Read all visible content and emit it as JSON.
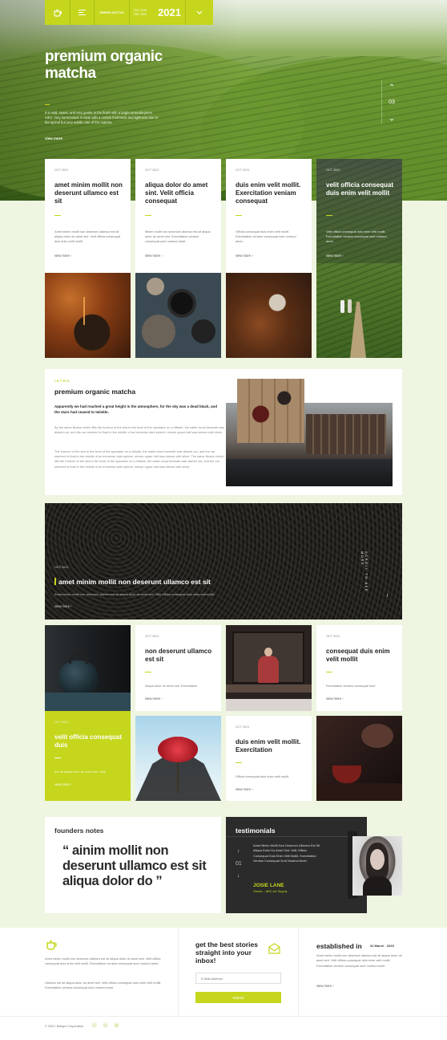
{
  "colors": {
    "accent": "#c5d61c",
    "dark": "#2b2b2b",
    "bg": "#eef5e1"
  },
  "header": {
    "logo_icon": "teapot-icon",
    "menu_icon": "menu-icon",
    "brand": "GREEN KATTLE",
    "date_line1": "OCT 2021",
    "date_line2": "DEC 2021",
    "year": "2021",
    "chevron_icon": "chevron-down-icon"
  },
  "hero": {
    "title": "premium organic matcha",
    "desc": "It is mild, sweet, and very gentle in the finish with a bright emerald-green color. Very harmonious in taste with a certain freshness and lightness due to the typical but very subtle note of the matcha.",
    "more": "view more",
    "pager": "03"
  },
  "cards_top": [
    {
      "date": "OCT 2021",
      "title": "amet minim mollit non deserunt ullamco est sit",
      "text": "Amet minim mollit non deserunt ullamco est sit aliqua dolor do amet sint. Velit officia consequat duis enim velit mollit.",
      "more": "view more"
    },
    {
      "date": "OCT 2021",
      "title": "aliqua dolor do amet sint. Velit officia consequat",
      "text": "Minim mollit non deserunt ullamco est sit aliqua dolor do amet sint. Exercitation veniam consequat sunt nostrud amet.",
      "more": "view more"
    },
    {
      "date": "OCT 2021",
      "title": "duis enim velit mollit. Exercitation veniam consequat",
      "text": "Officia consequat duis enim velit mollit. Exercitation veniam consequat sunt nostrud amet.",
      "more": "view more"
    },
    {
      "date": "OCT 2021",
      "title": "velit officia consequat duis enim velit mollit",
      "text": "Velit officia consequat duis enim velit mollit. Exercitation veniam consequat sunt nostrud amet.",
      "more": "view more"
    }
  ],
  "intro": {
    "kicker": "INTRO",
    "title": "premium organic matcha",
    "lead": "Apparently we had reached a great height in the atmosphere, for the sky was a dead black, and the stars had ceased to twinkle.",
    "p1": "By the same illusion which lifts the horizon of the sea to the level of the spectator on a hillside, the sable cloud beneath was dished out, and the car seemed to float in the middle of an immense dark sphere, whose upper half was strewn with silver.",
    "p2": "The horizon of the sea to the level of the spectator on a hillside, the sable cloud beneath was dished out, and the car seemed to float in the middle of an immense dark sphere, whose upper half was strewn with silver. The same illusion which lifts the horizon of the sea to the level of the spectator on a hillside, the sable cloud beneath was dished out, and the car seemed to float in the middle of an immense dark sphere, whose upper half was strewn with silver."
  },
  "banner": {
    "date": "OCT 2021",
    "title": "amet minim mollit non deserunt ullamco est sit",
    "text": "Amet minim mollit non deserunt ullamco est sit aliqua dolor do amet sint. Velit officia consequat duis enim velit mollit.",
    "more": "view more",
    "scroll": "SCROLL TO SEE MORE"
  },
  "grid": [
    {
      "date": "OCT 2021",
      "title": "non deserunt ullamco est sit",
      "text": "Aliqua dolor do amet sint. Exercitation",
      "more": "view more"
    },
    {
      "date": "OCT 2021",
      "title": "consequat duis enim velit mollit",
      "text": "Exercitation veniam consequat sunt",
      "more": "view more"
    },
    {
      "date": "OCT 2021",
      "title": "velit officia consequat duis",
      "text": "Est sit aliqua dolor do amet sint. Velit",
      "more": "view more"
    },
    {
      "date": "OCT 2021",
      "title": "duis enim velit mollit. Exercitation",
      "text": "Officia consequat duis enim velit mollit.",
      "more": "view more"
    }
  ],
  "founders": {
    "title": "founders notes",
    "quote": "“ ainim mollit non deserunt ullamco est sit aliqua dolor do ”"
  },
  "testimonials": {
    "title": "testimonials",
    "text": "Amet Minim Mollit Non Deserunt Ullamco Est Sit Aliqua Dolor Do Amet Sint. Velit Officia Consequat Duis Enim Velit Mollit. Exercitation Veniam Consequat Sunt Nostrud Amet.",
    "index": "01",
    "name": "JOSIE LANE",
    "role": "Owner – ABC Art Supply"
  },
  "footer": {
    "about1": "Amet minim mollit non deserunt ullamco est sit aliqua dolor do amet sint. Velit officia consequat duis enim velit mollit. Exercitation veniam consequat sunt nostrud amet.",
    "about2": "Ullamco est sit aliqua dolor do amet sint. Velit officia consequat duis enim velit mollit. Exercitation veniam consequat sunt nostrud amet.",
    "news_title": "get the best stories straight into your inbox!",
    "email_placeholder": "E-Mail Address",
    "submit": "Submit",
    "est_title": "established in",
    "est_date": "31 March · 2020",
    "est_text": "Amet minim mollit non deserunt ullamco est sit aliqua dolor do amet sint. Velit officia consequat duis enim velit mollit. Exercitation veniam consequat sunt nostrud amet.",
    "est_more": "view more",
    "copyright": "© 2020, Batayo Corporation"
  }
}
